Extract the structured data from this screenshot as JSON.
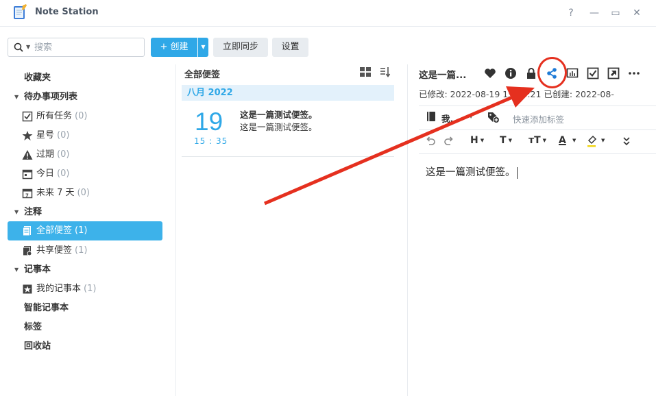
{
  "window": {
    "title": "Note Station",
    "help_glyph": "?",
    "minimize_glyph": "—",
    "maximize_glyph": "▭",
    "close_glyph": "✕"
  },
  "toolbar": {
    "search_placeholder": "搜索",
    "create_label": "+ 创建",
    "sync_label": "立即同步",
    "settings_label": "设置"
  },
  "sidebar": {
    "favorites": "收藏夹",
    "todo_header": "待办事项列表",
    "todo_items": [
      {
        "label": "所有任务",
        "count": "(0)"
      },
      {
        "label": "星号",
        "count": "(0)"
      },
      {
        "label": "过期",
        "count": "(0)"
      },
      {
        "label": "今日",
        "count": "(0)"
      },
      {
        "label": "未来 7 天",
        "count": "(0)"
      }
    ],
    "notes_header": "注释",
    "notes_items": [
      {
        "label": "全部便签",
        "count": "(1)"
      },
      {
        "label": "共享便签",
        "count": "(1)"
      }
    ],
    "notebooks_header": "记事本",
    "notebook_items": [
      {
        "label": "我的记事本",
        "count": "(1)"
      }
    ],
    "smart_notebook": "智能记事本",
    "tags": "标签",
    "trash": "回收站"
  },
  "notelist": {
    "header": "全部便签",
    "month": "八月 2022",
    "entry": {
      "day": "19",
      "time": "15 : 35",
      "title": "这是一篇测试便签。",
      "preview": "这是一篇测试便签。"
    }
  },
  "editor": {
    "title": "这是一篇...",
    "meta": "已修改:  2022-08-19 15:35:21    已创建:  2022-08-",
    "notebook_label": "我...",
    "tag_placeholder": "快速添加标签",
    "body": "这是一篇测试便签。",
    "format": {
      "heading": "H",
      "text": "T",
      "size": "тT",
      "color": "A"
    }
  },
  "colors": {
    "accent": "#2fa8e7",
    "sidebar_active": "#3db2ea",
    "annotation": "#e5301f"
  }
}
